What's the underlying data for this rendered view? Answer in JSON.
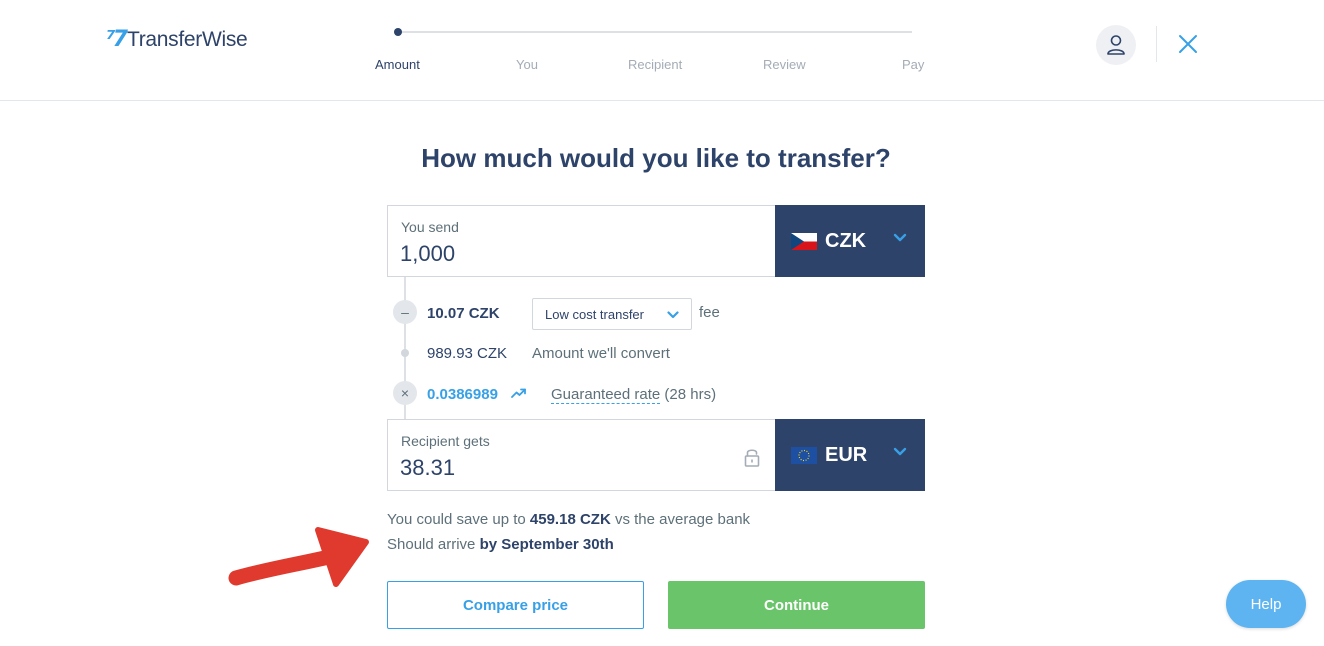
{
  "brand": {
    "name": "TransferWise",
    "mark": "⁷7"
  },
  "stepper": {
    "steps": [
      "Amount",
      "You",
      "Recipient",
      "Review",
      "Pay"
    ],
    "active_index": 0
  },
  "colors": {
    "navy": "#2e4369",
    "accent_blue": "#37a0e6",
    "green": "#6ac56a",
    "help_blue": "#5db4f0",
    "annotation_red": "#e03a2e"
  },
  "page": {
    "title": "How much would you like to transfer?"
  },
  "send": {
    "label": "You send",
    "value": "1,000",
    "currency": "CZK",
    "flag": "czech-flag"
  },
  "breakdown": {
    "fee_amount": "10.07 CZK",
    "fee_type": "Low cost transfer",
    "fee_suffix": "fee",
    "convert_amount": "989.93 CZK",
    "convert_label": "Amount we'll convert",
    "rate": "0.0386989",
    "rate_label": "Guaranteed rate",
    "rate_duration": "(28 hrs)",
    "minus_symbol": "–",
    "times_symbol": "×"
  },
  "receive": {
    "label": "Recipient gets",
    "value": "38.31",
    "currency": "EUR",
    "flag": "eu-flag"
  },
  "savings": {
    "prefix": "You could save up to",
    "amount": "459.18 CZK",
    "suffix": "vs the average bank"
  },
  "arrival": {
    "prefix": "Should arrive",
    "date": "by September 30th"
  },
  "buttons": {
    "compare": "Compare price",
    "continue": "Continue",
    "help": "Help"
  }
}
